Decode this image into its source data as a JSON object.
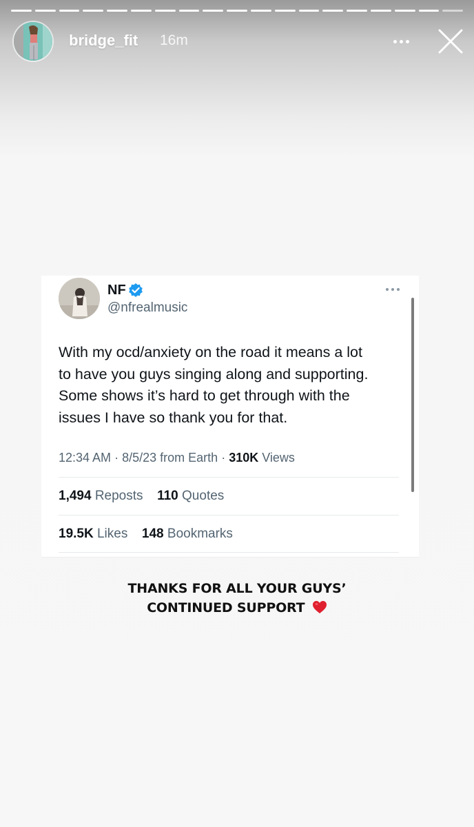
{
  "story": {
    "segments_total": 19,
    "segments_done": 18,
    "username": "bridge_fit",
    "time_ago": "16m",
    "more_icon": "more-horizontal-icon",
    "close_icon": "close-icon",
    "caption_line1": "THANKS FOR ALL YOUR GUYS’",
    "caption_line2": "CONTINUED SUPPORT",
    "caption_emoji": "heart-icon",
    "heart_color": "#e0202e"
  },
  "tweet": {
    "name": "NF",
    "handle": "@nfrealmusic",
    "verified_color": "#1d9bf0",
    "body_lines": [
      "With my ocd/anxiety on the road it means a lot",
      "to have you guys singing along and supporting.",
      "Some shows it’s hard to get through with the",
      "issues I have so thank you for that."
    ],
    "time": "12:34 AM",
    "date": "8/5/23",
    "source": "from Earth",
    "views_count": "310K",
    "views_label": "Views",
    "reposts_count": "1,494",
    "reposts_label": "Reposts",
    "quotes_count": "110",
    "quotes_label": "Quotes",
    "likes_count": "19.5K",
    "likes_label": "Likes",
    "bookmarks_count": "148",
    "bookmarks_label": "Bookmarks"
  }
}
